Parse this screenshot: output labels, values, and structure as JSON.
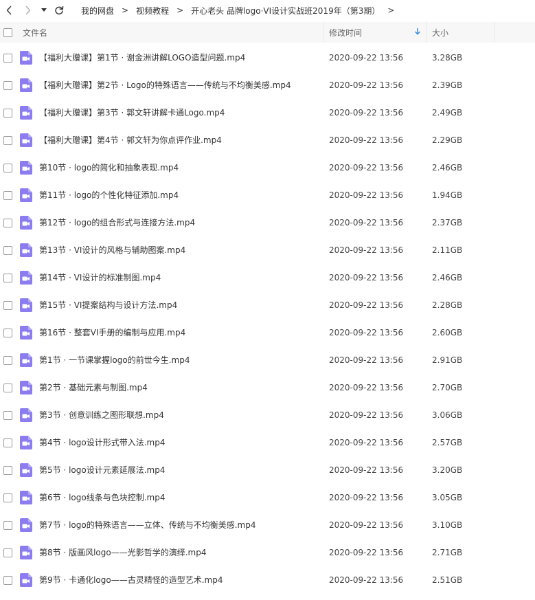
{
  "nav": {
    "back_icon": "chevron-left-icon",
    "forward_icon": "chevron-right-icon",
    "dropdown_icon": "caret-down-icon",
    "refresh_icon": "refresh-icon"
  },
  "breadcrumb": [
    "我的网盘",
    "视频教程",
    "开心老头 品牌logo·VI设计实战班2019年（第3期）"
  ],
  "breadcrumb_sep": ">",
  "columns": {
    "name": "文件名",
    "modified": "修改时间",
    "size": "大小",
    "sort_icon": "arrow-down-icon",
    "sort_color": "#3b8de0"
  },
  "file_icon": {
    "name": "video-file-icon",
    "color": "#8b7cf0"
  },
  "files": [
    {
      "name": "【福利大赠课】第1节 · 谢金洲讲解LOGO造型问题.mp4",
      "modified": "2020-09-22 13:56",
      "size": "3.28GB"
    },
    {
      "name": "【福利大赠课】第2节 · Logo的特殊语言——传统与不均衡美感.mp4",
      "modified": "2020-09-22 13:56",
      "size": "2.39GB"
    },
    {
      "name": "【福利大赠课】第3节 · 郭文轩讲解卡通Logo.mp4",
      "modified": "2020-09-22 13:56",
      "size": "2.49GB"
    },
    {
      "name": "【福利大赠课】第4节 · 郭文轩为你点评作业.mp4",
      "modified": "2020-09-22 13:56",
      "size": "2.29GB"
    },
    {
      "name": "第10节 · logo的简化和抽象表现.mp4",
      "modified": "2020-09-22 13:56",
      "size": "2.46GB"
    },
    {
      "name": "第11节 · logo的个性化特征添加.mp4",
      "modified": "2020-09-22 13:56",
      "size": "1.94GB"
    },
    {
      "name": "第12节 · logo的组合形式与连接方法.mp4",
      "modified": "2020-09-22 13:56",
      "size": "2.37GB"
    },
    {
      "name": "第13节 · VI设计的风格与辅助图案.mp4",
      "modified": "2020-09-22 13:56",
      "size": "2.11GB"
    },
    {
      "name": "第14节 · VI设计的标准制图.mp4",
      "modified": "2020-09-22 13:56",
      "size": "2.46GB"
    },
    {
      "name": "第15节 · VI提案结构与设计方法.mp4",
      "modified": "2020-09-22 13:56",
      "size": "2.28GB"
    },
    {
      "name": "第16节 · 整套VI手册的编制与应用.mp4",
      "modified": "2020-09-22 13:56",
      "size": "2.60GB"
    },
    {
      "name": "第1节 · 一节课掌握logo的前世今生.mp4",
      "modified": "2020-09-22 13:56",
      "size": "2.91GB"
    },
    {
      "name": "第2节 · 基础元素与制图.mp4",
      "modified": "2020-09-22 13:56",
      "size": "2.70GB"
    },
    {
      "name": "第3节 · 创意训练之图形联想.mp4",
      "modified": "2020-09-22 13:56",
      "size": "3.06GB"
    },
    {
      "name": "第4节 · logo设计形式带入法.mp4",
      "modified": "2020-09-22 13:56",
      "size": "2.57GB"
    },
    {
      "name": "第5节 · logo设计元素延展法.mp4",
      "modified": "2020-09-22 13:56",
      "size": "3.20GB"
    },
    {
      "name": "第6节 · logo线条与色块控制.mp4",
      "modified": "2020-09-22 13:56",
      "size": "3.05GB"
    },
    {
      "name": "第7节 · logo的特殊语言——立体、传统与不均衡美感.mp4",
      "modified": "2020-09-22 13:56",
      "size": "3.10GB"
    },
    {
      "name": "第8节 · 版画风logo——光影哲学的演绎.mp4",
      "modified": "2020-09-22 13:56",
      "size": "2.71GB"
    },
    {
      "name": "第9节 · 卡通化logo——古灵精怪的造型艺术.mp4",
      "modified": "2020-09-22 13:56",
      "size": "2.51GB"
    }
  ]
}
